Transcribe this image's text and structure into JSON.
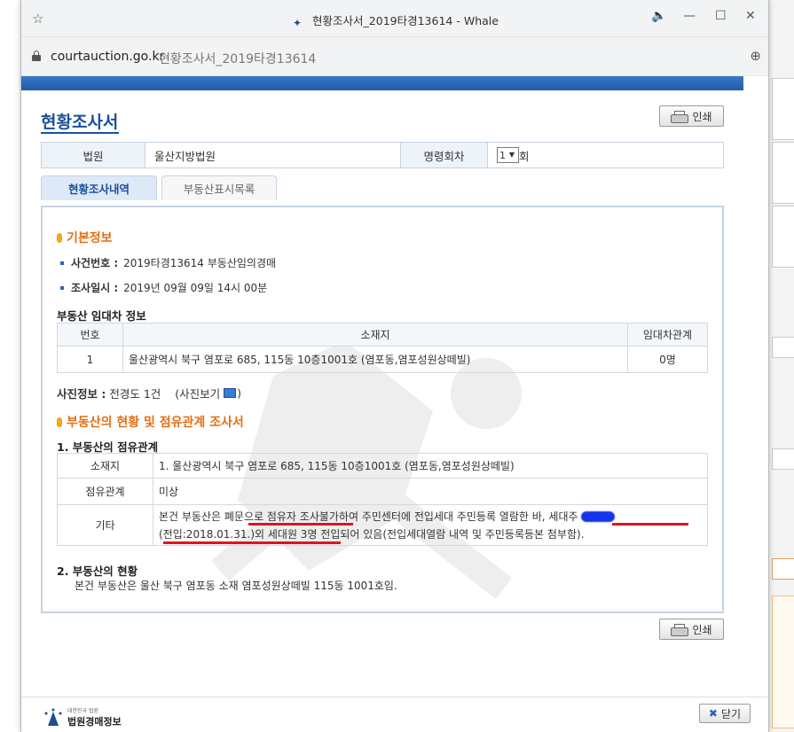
{
  "browser": {
    "window_title": "현황조사서_2019타경13614 - Whale",
    "address_domain": "courtauction.go.kr",
    "address_page_title": "현황조사서_2019타경13614"
  },
  "page": {
    "title": "현황조사서",
    "print_label": "인쇄",
    "court_label": "법원",
    "court_value": "울산지방법원",
    "order_label": "명령회차",
    "order_value": "1",
    "order_suffix": "회",
    "tabs": [
      {
        "label": "현황조사내역",
        "active": true
      },
      {
        "label": "부동산표시목록",
        "active": false
      }
    ]
  },
  "basic_info": {
    "heading": "기본정보",
    "case_no_label": "사건번호 :",
    "case_no_value": "2019타경13614 부동산임의경매",
    "survey_date_label": "조사일시 :",
    "survey_date_value": "2019년 09월 09일 14시 00분"
  },
  "lease_info": {
    "heading": "부동산 임대차 정보",
    "headers": [
      "번호",
      "소재지",
      "임대차관계"
    ],
    "rows": [
      [
        "1",
        "울산광역시 북구 염포로 685, 115동 10층1001호 (염포동,염포성원상떼빌)",
        "0명"
      ]
    ]
  },
  "photo_info": {
    "label": "사진정보 :",
    "value": "전경도 1건",
    "view_open": "(사진보기",
    "view_close": ")"
  },
  "occupancy": {
    "heading": "부동산의 현황 및 점유관계 조사서",
    "sub1": "1. 부동산의 점유관계",
    "rows": [
      {
        "label": "소재지",
        "value": "1. 울산광역시 북구 염포로 685, 115동 10층1001호 (염포동,염포성원상떼빌)"
      },
      {
        "label": "점유관계",
        "value": "미상"
      }
    ],
    "etc_label": "기타",
    "etc_line1_a": "본건 부동산은 ",
    "etc_line1_b": "폐문으로 점유자 조사불가",
    "etc_line1_c": "하여 주민센터에 전입세대 주민등록 열람한 바, ",
    "etc_line1_d": "세대주",
    "etc_line2_a": "(전입:2018.01.31.)외 세대원 3명 전입",
    "etc_line2_b": "되어 있음(전입세대열람 내역 및 주민등록등본 첨부함).",
    "sub2": "2. 부동산의 현황",
    "status_text": "본건 부동산은 울산 북구 염포동 소재 염포성원상떼빌 115동 1001호임."
  },
  "footer": {
    "logo_small": "대한민국 법원",
    "logo_big": "법원경매정보",
    "close_label": "닫기"
  },
  "colors": {
    "accent_blue": "#1a4f9a",
    "section_orange": "#e46f12",
    "underline_red": "#e0141c"
  }
}
